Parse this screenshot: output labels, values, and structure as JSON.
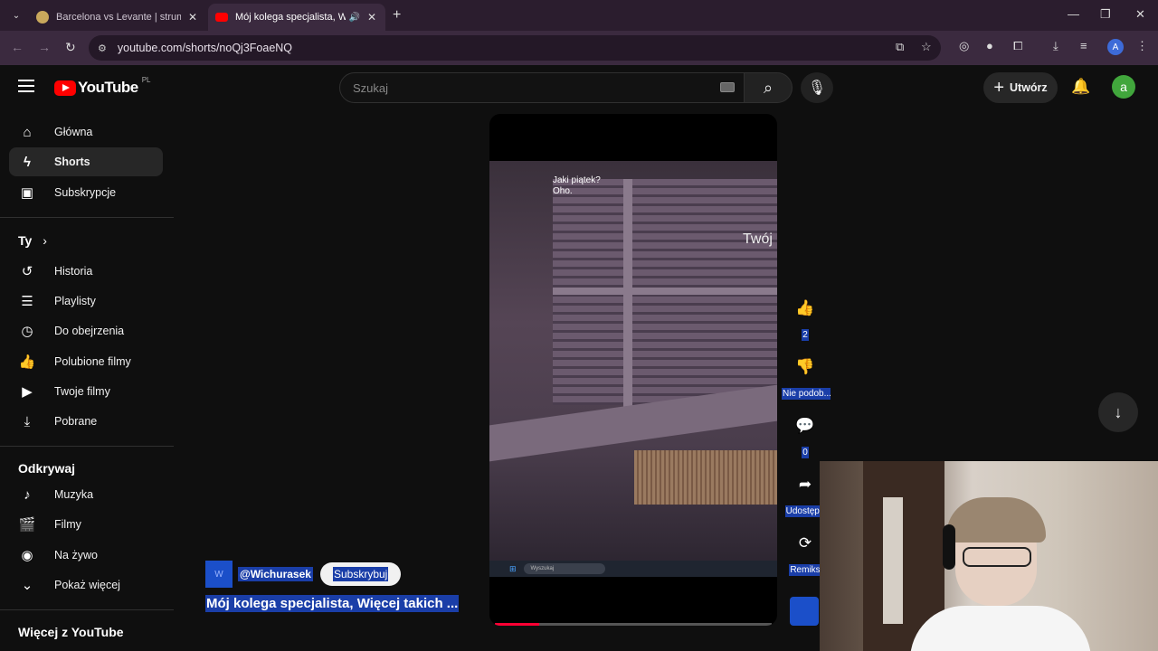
{
  "browser": {
    "tabs": [
      {
        "title": "Barcelona vs Levante | strumyk...",
        "active": false
      },
      {
        "title": "Mój kolega specjalista, Więc...",
        "active": true
      }
    ],
    "url": "youtube.com/shorts/noQj3FoaeNQ",
    "profile_initial": "A"
  },
  "header": {
    "logo_text": "YouTube",
    "country_code": "PL",
    "search_placeholder": "Szukaj",
    "create_label": "Utwórz",
    "avatar_initial": "a"
  },
  "sidebar": {
    "main": [
      {
        "label": "Główna",
        "icon": "home-icon"
      },
      {
        "label": "Shorts",
        "icon": "shorts-icon"
      },
      {
        "label": "Subskrypcje",
        "icon": "subscriptions-icon"
      }
    ],
    "you_heading": "Ty",
    "you": [
      {
        "label": "Historia",
        "icon": "history-icon"
      },
      {
        "label": "Playlisty",
        "icon": "playlist-icon"
      },
      {
        "label": "Do obejrzenia",
        "icon": "watch-later-icon"
      },
      {
        "label": "Polubione filmy",
        "icon": "like-icon"
      },
      {
        "label": "Twoje filmy",
        "icon": "your-videos-icon"
      },
      {
        "label": "Pobrane",
        "icon": "download-icon"
      }
    ],
    "explore_heading": "Odkrywaj",
    "explore": [
      {
        "label": "Muzyka",
        "icon": "music-icon"
      },
      {
        "label": "Filmy",
        "icon": "movies-icon"
      },
      {
        "label": "Na żywo",
        "icon": "live-icon"
      },
      {
        "label": "Pokaż więcej",
        "icon": "chevron-down-icon"
      }
    ],
    "more_heading": "Więcej z YouTube"
  },
  "video": {
    "caption_line1": "Jaki piątek?",
    "caption_line2": "Oho.",
    "overlay_word": "Twój",
    "taskbar_search": "Wyszukaj",
    "progress": 0.16,
    "channel": "@Wichurasek",
    "subscribe_label": "Subskrybuj",
    "title": "Mój kolega specjalista, Więcej takich ..."
  },
  "actions": {
    "likes": "2",
    "dislike_label": "Nie podob...",
    "comments": "0",
    "share_label": "Udostępn",
    "remix_label": "Remiks"
  }
}
